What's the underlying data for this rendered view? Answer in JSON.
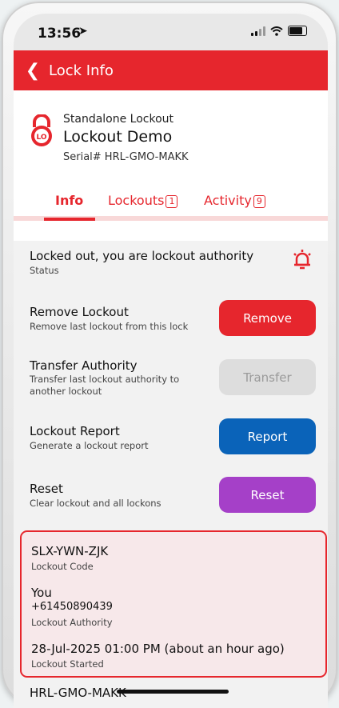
{
  "status_bar": {
    "time": "13:56"
  },
  "nav": {
    "back_label": "Lock Info"
  },
  "lock": {
    "type": "Standalone Lockout",
    "name": "Lockout Demo",
    "serial": "Serial# HRL-GMO-MAKK",
    "icon_text": "LO"
  },
  "tabs": [
    {
      "label": "Info",
      "count": ""
    },
    {
      "label": "Lockouts",
      "count": "1"
    },
    {
      "label": "Activity",
      "count": "9"
    }
  ],
  "status": {
    "title": "Locked out, you are lockout authority",
    "subtitle": "Status"
  },
  "actions": {
    "remove": {
      "title": "Remove Lockout",
      "subtitle": "Remove last lockout from this lock",
      "button": "Remove"
    },
    "transfer": {
      "title": "Transfer Authority",
      "subtitle": "Transfer last lockout authority to another lockout",
      "button": "Transfer"
    },
    "report": {
      "title": "Lockout Report",
      "subtitle": "Generate a lockout report",
      "button": "Report"
    },
    "reset": {
      "title": "Reset",
      "subtitle": "Clear lockout and all lockons",
      "button": "Reset"
    }
  },
  "card": {
    "code": "SLX-YWN-ZJK",
    "code_label": "Lockout Code",
    "authority_name": "You",
    "authority_phone": "+61450890439",
    "authority_label": "Lockout Authority",
    "started": "28-Jul-2025 01:00 PM (about an hour ago)",
    "started_label": "Lockout Started"
  },
  "next_item_partial": "HRL-GMO-MAKK",
  "colors": {
    "brand_red": "#e6262d",
    "report_blue": "#0a63b9",
    "reset_purple": "#a540c8",
    "transfer_disabled": "#dddddd"
  }
}
